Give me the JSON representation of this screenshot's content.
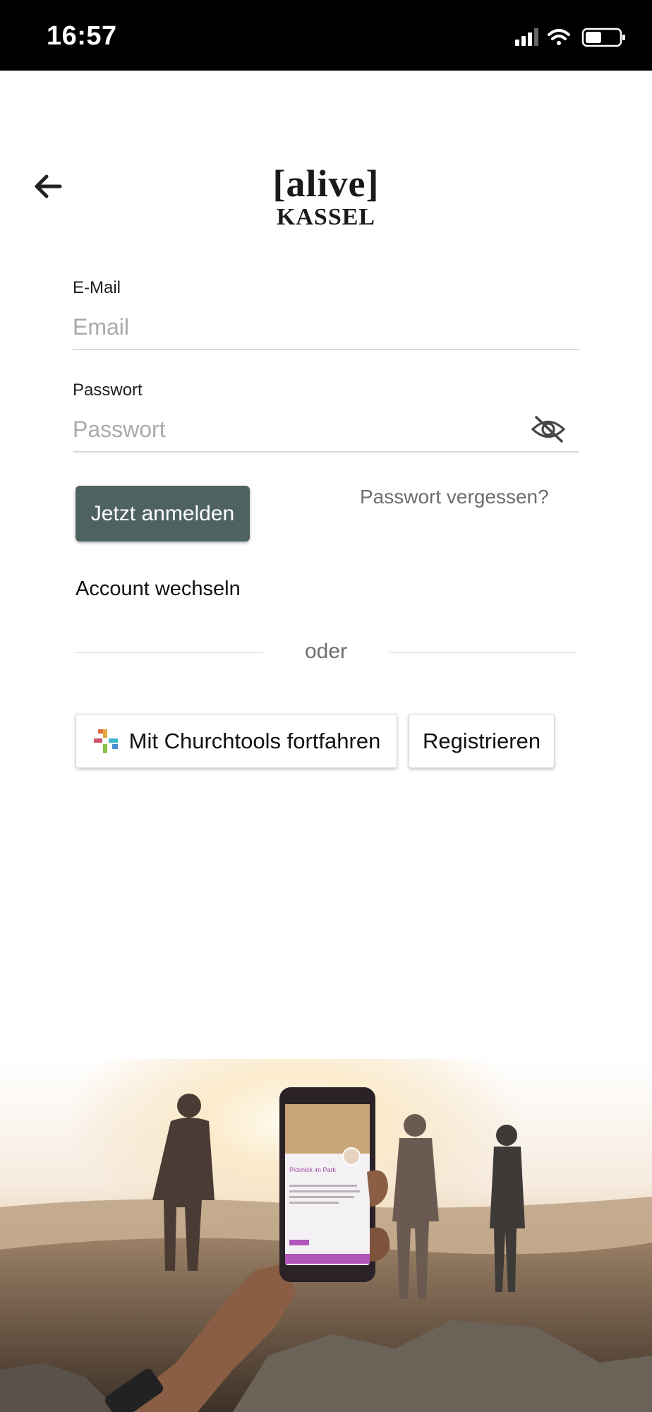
{
  "status_bar": {
    "time": "16:57"
  },
  "header": {
    "back_icon": "arrow-left-icon",
    "logo": {
      "line1": "[alive]",
      "line2": "KASSEL"
    }
  },
  "form": {
    "email": {
      "label": "E-Mail",
      "placeholder": "Email"
    },
    "password": {
      "label": "Passwort",
      "placeholder": "Passwort",
      "toggle_icon": "eye-off-icon"
    },
    "login_label": "Jetzt anmelden",
    "forgot_label": "Passwort vergessen?",
    "switch_account_label": "Account wechseln",
    "divider_text": "oder",
    "churchtools_label": "Mit Churchtools fortfahren",
    "register_label": "Registrieren"
  },
  "hero_phone": {
    "title": "Picknick im Park"
  },
  "colors": {
    "primary": "#4e6262",
    "status_bar": "#000000"
  }
}
